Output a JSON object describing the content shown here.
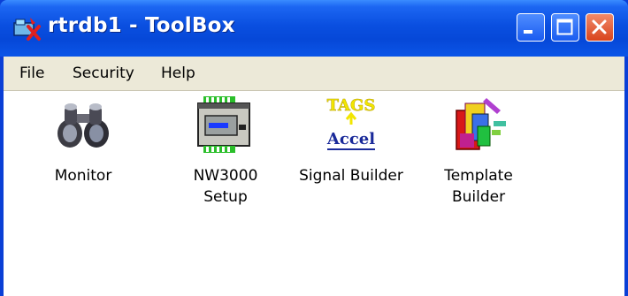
{
  "window": {
    "title": "rtrdb1 - ToolBox",
    "app_icon": "toolbox-icon"
  },
  "title_buttons": {
    "minimize": "minimize-icon",
    "maximize": "maximize-icon",
    "close": "close-icon"
  },
  "menu": {
    "items": [
      {
        "label": "File"
      },
      {
        "label": "Security"
      },
      {
        "label": "Help"
      }
    ]
  },
  "tools": [
    {
      "label": "Monitor",
      "icon": "binoculars-icon"
    },
    {
      "label": "NW3000\nSetup",
      "icon": "network-device-icon"
    },
    {
      "label": "Signal Builder",
      "icon": "tags-accel-icon",
      "icon_text_top": "TAGS",
      "icon_text_bottom": "Accel"
    },
    {
      "label": "Template\nBuilder",
      "icon": "template-blocks-icon"
    }
  ],
  "colors": {
    "titlebar": "#0a4fe0",
    "menubar": "#ece9d8",
    "close_button": "#d9441c",
    "client_background": "#ffffff"
  }
}
